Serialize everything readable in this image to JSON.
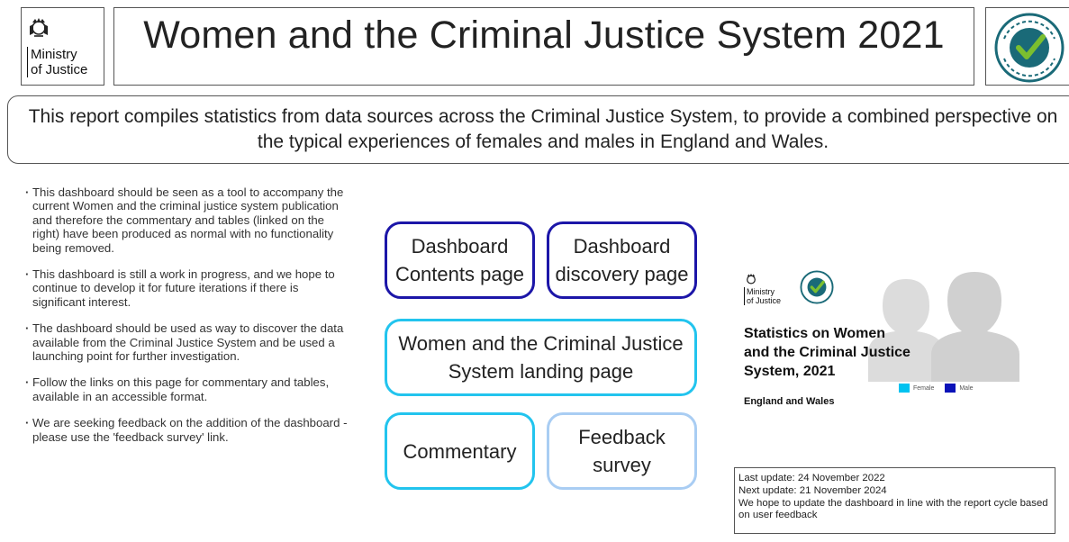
{
  "header": {
    "logo_line1": "Ministry",
    "logo_line2": "of Justice",
    "title": "Women and the Criminal Justice System 2021",
    "badge_icon": "national-statistics-badge"
  },
  "intro": {
    "text": "This report compiles statistics from data sources across the Criminal Justice System, to provide a combined perspective on the typical experiences of females and males in England and Wales."
  },
  "bullets": [
    "This dashboard should be seen as a tool to accompany the current Women and the criminal justice system publication and therefore the commentary and tables (linked on the right) have been produced as normal with no functionality being removed.",
    "This dashboard is still a work in progress, and we hope to continue to develop it for future iterations if there is significant interest.",
    "The dashboard should be used as way to discover the data available from the Criminal Justice System and be used a launching point for further investigation.",
    "Follow the links on this page for commentary and tables, available in an accessible format.",
    "We are seeking feedback on the addition of the dashboard - please use the 'feedback survey' link."
  ],
  "nav": {
    "contents_line1": "Dashboard",
    "contents_line2": "Contents page",
    "discovery_line1": "Dashboard",
    "discovery_line2": "discovery page",
    "landing_line1": "Women and the Criminal Justice",
    "landing_line2": "System landing page",
    "commentary": "Commentary",
    "feedback_line1": "Feedback",
    "feedback_line2": "survey"
  },
  "cover": {
    "moj_line1": "Ministry",
    "moj_line2": "of Justice",
    "title_line1": "Statistics on Women",
    "title_line2": "and the Criminal Justice",
    "title_line3": "System, 2021",
    "subtitle": "England and Wales",
    "legend_female": "Female",
    "legend_male": "Male",
    "female_color": "#00c2f0",
    "male_color": "#0a12b8"
  },
  "update": {
    "last_update": "Last update: 24 November 2022",
    "next_update": "Next update: 21 November 2024",
    "note": "We hope to update the dashboard in line with the report cycle based on user feedback"
  },
  "colors": {
    "dark_blue_border": "#1c16a8",
    "cyan_border": "#22c4ee",
    "light_blue_border": "#a9cdf3",
    "badge_teal": "#1a6a78",
    "badge_green": "#7bbf2f"
  }
}
